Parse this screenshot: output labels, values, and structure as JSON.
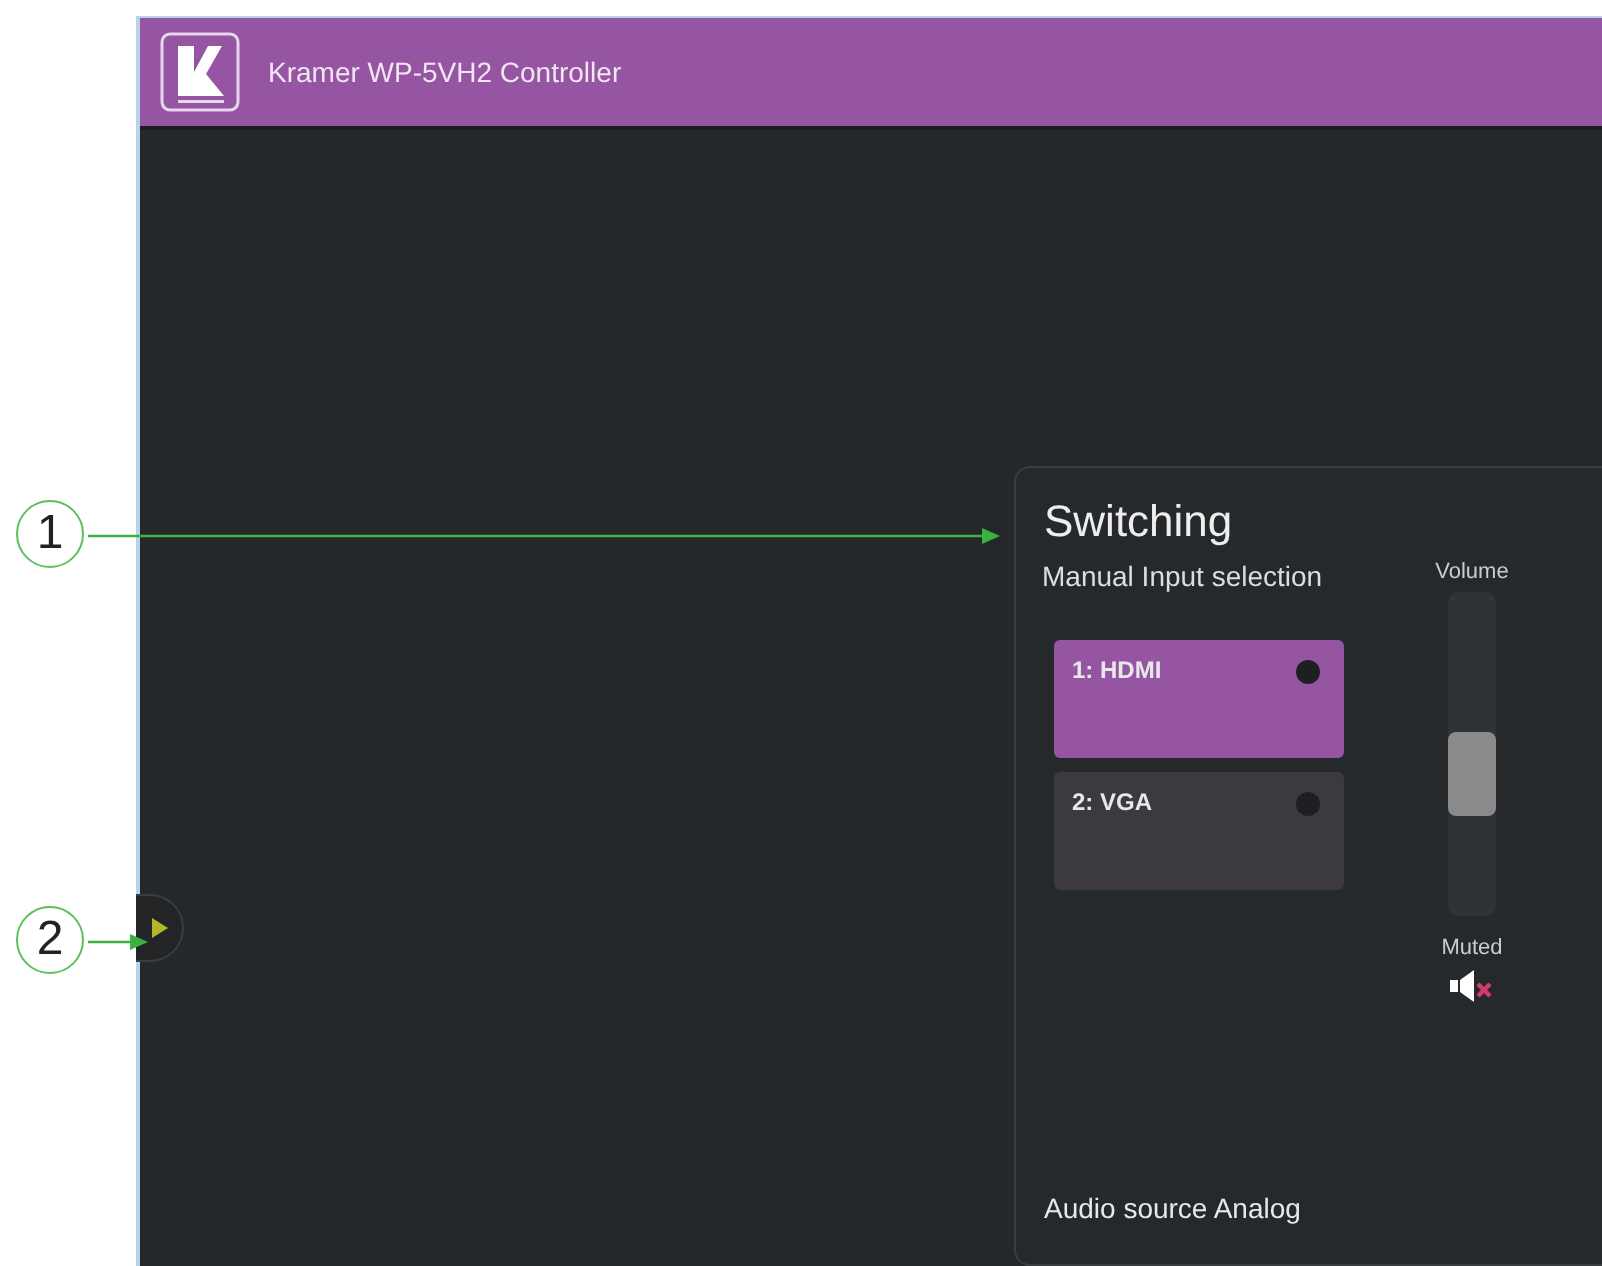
{
  "header": {
    "title": "Kramer WP-5VH2 Controller"
  },
  "panel": {
    "title": "Switching",
    "subtitle": "Manual Input selection",
    "inputs": [
      {
        "label": "1: HDMI",
        "selected": true
      },
      {
        "label": "2: VGA",
        "selected": false
      }
    ],
    "volume": {
      "label": "Volume",
      "level": 0.42
    },
    "mute": {
      "label": "Muted",
      "muted": true
    },
    "audio_source": "Audio source Analog"
  },
  "sidebar_toggle": {
    "expanded": false
  },
  "callouts": [
    {
      "number": "1",
      "kind": "panel"
    },
    {
      "number": "2",
      "kind": "toggle"
    }
  ]
}
